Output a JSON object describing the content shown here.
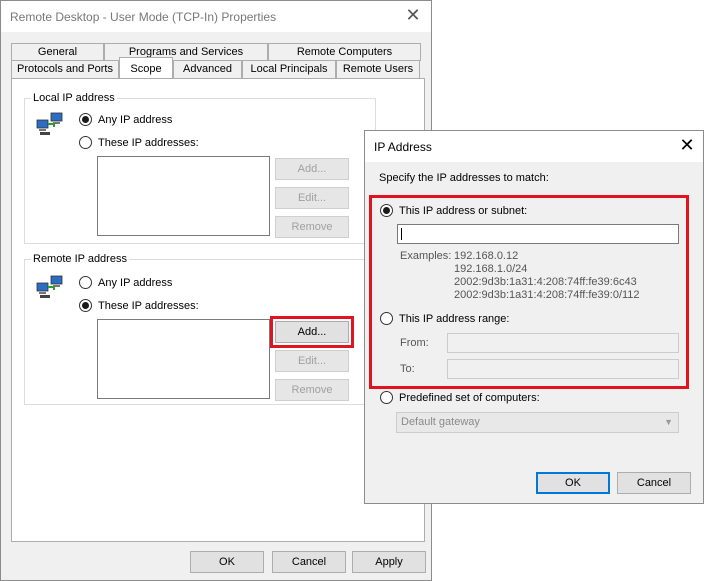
{
  "main_window": {
    "title": "Remote Desktop - User Mode (TCP-In) Properties",
    "close_glyph": "✕",
    "tabs_row1": [
      "General",
      "Programs and Services",
      "Remote Computers"
    ],
    "tabs_row2": [
      "Protocols and Ports",
      "Scope",
      "Advanced",
      "Local Principals",
      "Remote Users"
    ],
    "local_group": {
      "label": "Local IP address",
      "radio_any": "Any IP address",
      "radio_these": "These IP addresses:",
      "selected": "any",
      "btn_add": "Add...",
      "btn_edit": "Edit...",
      "btn_remove": "Remove"
    },
    "remote_group": {
      "label": "Remote IP address",
      "radio_any": "Any IP address",
      "radio_these": "These IP addresses:",
      "selected": "these",
      "btn_add": "Add...",
      "btn_edit": "Edit...",
      "btn_remove": "Remove"
    },
    "footer": {
      "ok": "OK",
      "cancel": "Cancel",
      "apply": "Apply"
    }
  },
  "ip_dialog": {
    "title": "IP Address",
    "close_glyph": "✕",
    "instruction": "Specify the IP addresses to match:",
    "option_subnet": "This IP address or subnet:",
    "subnet_value": "",
    "examples_label": "Examples:",
    "examples": [
      "192.168.0.12",
      "192.168.1.0/24",
      "2002:9d3b:1a31:4:208:74ff:fe39:6c43",
      "2002:9d3b:1a31:4:208:74ff:fe39:0/112"
    ],
    "option_range": "This IP address range:",
    "from_label": "From:",
    "to_label": "To:",
    "option_predefined": "Predefined set of computers:",
    "predefined_value": "Default gateway",
    "ok": "OK",
    "cancel": "Cancel"
  },
  "colors": {
    "highlight": "#e0141e",
    "focus": "#0078d7"
  }
}
